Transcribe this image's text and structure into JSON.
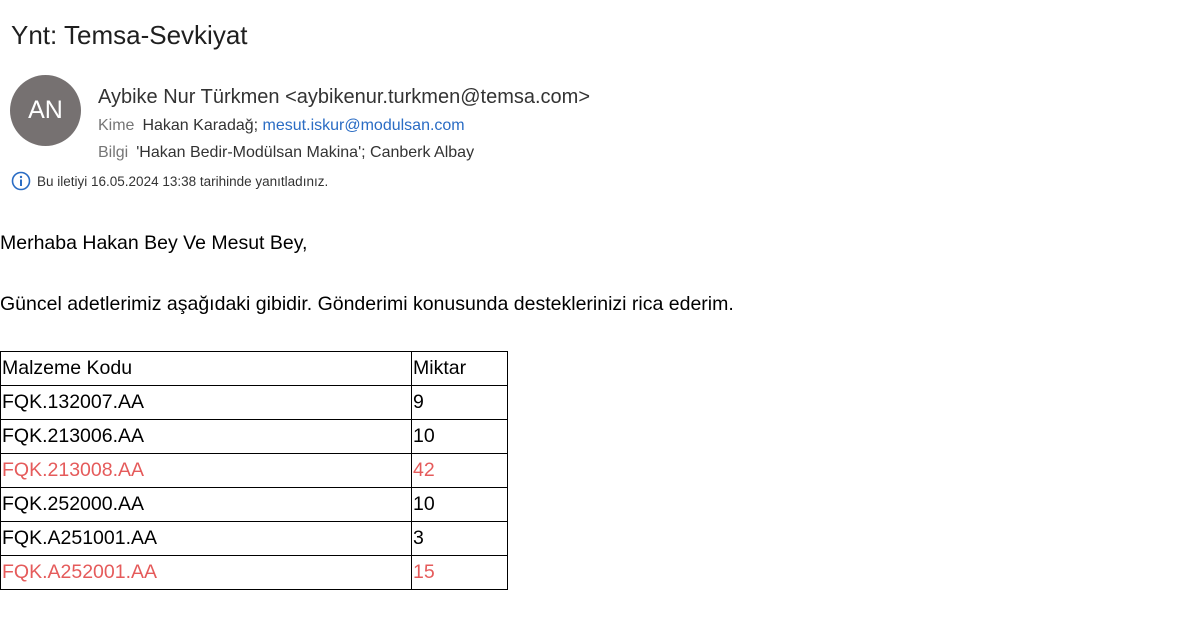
{
  "email": {
    "subject": "Ynt: Temsa-Sevkiyat",
    "avatar_initials": "AN",
    "avatar_color": "#767171",
    "sender": "Aybike Nur Türkmen <aybikenur.turkmen@temsa.com>",
    "to_label": "Kime",
    "to_name": "Hakan Karadağ;",
    "to_link": "mesut.iskur@modulsan.com",
    "cc_label": "Bilgi",
    "cc_value": "'Hakan Bedir-Modülsan Makina'; Canberk Albay",
    "info_text": "Bu iletiyi 16.05.2024 13:38 tarihinde yanıtladınız.",
    "info_icon": "info-icon"
  },
  "body": {
    "greeting": "Merhaba Hakan Bey Ve Mesut Bey,",
    "paragraph": "Güncel adetlerimiz aşağıdaki gibidir. Gönderimi konusunda desteklerinizi rica ederim."
  },
  "table": {
    "headers": [
      "Malzeme Kodu",
      "Miktar"
    ],
    "rows": [
      {
        "code": "FQK.132007.AA",
        "qty": "9",
        "highlight": false
      },
      {
        "code": "FQK.213006.AA",
        "qty": "10",
        "highlight": false
      },
      {
        "code": "FQK.213008.AA",
        "qty": "42",
        "highlight": true
      },
      {
        "code": "FQK.252000.AA",
        "qty": "10",
        "highlight": false
      },
      {
        "code": "FQK.A251001.AA",
        "qty": "3",
        "highlight": false
      },
      {
        "code": "FQK.A252001.AA",
        "qty": "15",
        "highlight": true
      }
    ],
    "highlight_color": "#e55b5b"
  }
}
